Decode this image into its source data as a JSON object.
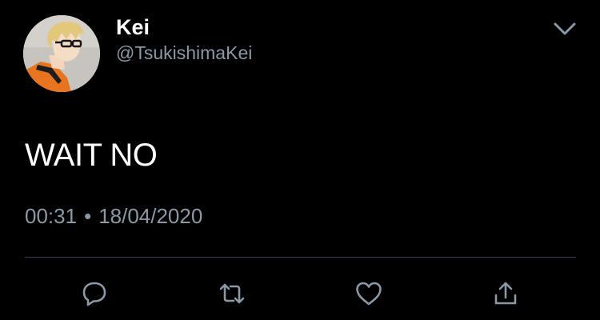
{
  "tweet": {
    "author": {
      "display_name": "Kei",
      "handle": "@TsukishimaKei",
      "avatar_icon": "profile-avatar"
    },
    "text": "WAIT NO",
    "time": "00:31",
    "separator": "•",
    "date": "18/04/2020"
  },
  "actions": {
    "reply_icon": "reply-icon",
    "retweet_icon": "retweet-icon",
    "like_icon": "heart-icon",
    "share_icon": "share-icon"
  },
  "colors": {
    "background": "#000000",
    "primary_text": "#ffffff",
    "secondary_text": "#8b98a5",
    "divider": "#38444d"
  }
}
